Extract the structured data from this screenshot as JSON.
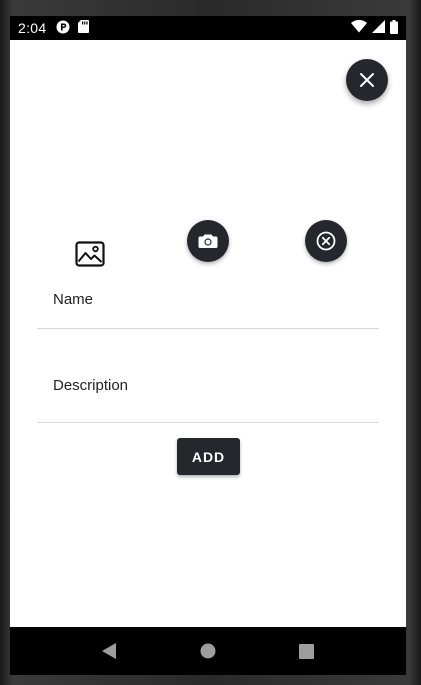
{
  "status_bar": {
    "time": "2:04",
    "left_icons": [
      "p-badge-icon",
      "sd-card-icon"
    ],
    "right_icons": [
      "wifi-icon",
      "cell-signal-icon",
      "battery-icon"
    ]
  },
  "toolbar": {
    "close_icon": "close-icon"
  },
  "image_actions": {
    "gallery_icon": "image-icon",
    "camera_icon": "camera-icon",
    "clear_icon": "cancel-circle-icon"
  },
  "form": {
    "name_label": "Name",
    "name_value": "",
    "description_label": "Description",
    "description_value": "",
    "add_label": "ADD"
  },
  "nav_bar": {
    "items": [
      "back-icon",
      "home-icon",
      "recents-icon"
    ]
  },
  "colors": {
    "dark_button": "#25272c",
    "divider": "#d9d9d9",
    "background": "#ffffff"
  }
}
